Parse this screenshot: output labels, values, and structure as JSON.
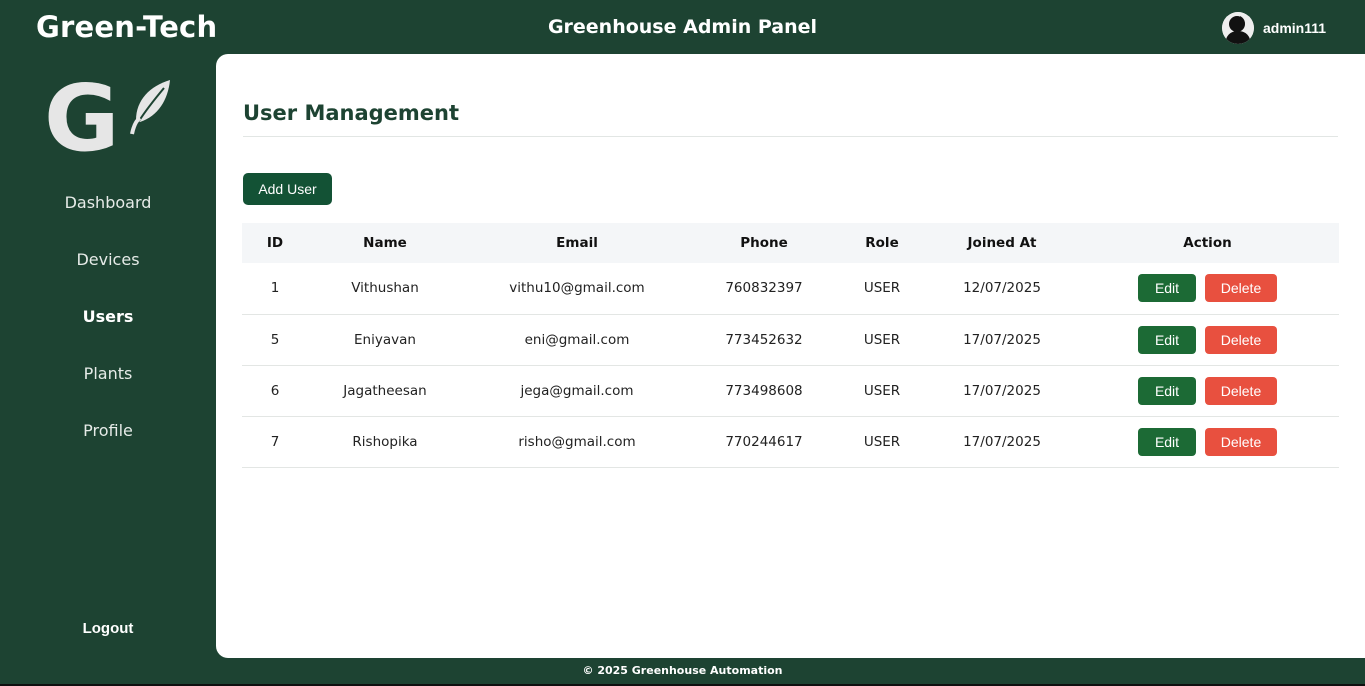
{
  "header": {
    "brand": "Green-Tech",
    "title": "Greenhouse Admin Panel",
    "username": "admin111"
  },
  "sidebar": {
    "logo_text": "G",
    "items": [
      {
        "label": "Dashboard",
        "active": false
      },
      {
        "label": "Devices",
        "active": false
      },
      {
        "label": "Users",
        "active": true
      },
      {
        "label": "Plants",
        "active": false
      },
      {
        "label": "Profile",
        "active": false
      }
    ],
    "logout": "Logout"
  },
  "main": {
    "title": "User Management",
    "add_button": "Add User",
    "table": {
      "headers": [
        "ID",
        "Name",
        "Email",
        "Phone",
        "Role",
        "Joined At",
        "Action"
      ],
      "rows": [
        {
          "id": "1",
          "name": "Vithushan",
          "email": "vithu10@gmail.com",
          "phone": "760832397",
          "role": "USER",
          "joined": "12/07/2025"
        },
        {
          "id": "5",
          "name": "Eniyavan",
          "email": "eni@gmail.com",
          "phone": "773452632",
          "role": "USER",
          "joined": "17/07/2025"
        },
        {
          "id": "6",
          "name": "Jagatheesan",
          "email": "jega@gmail.com",
          "phone": "773498608",
          "role": "USER",
          "joined": "17/07/2025"
        },
        {
          "id": "7",
          "name": "Rishopika",
          "email": "risho@gmail.com",
          "phone": "770244617",
          "role": "USER",
          "joined": "17/07/2025"
        }
      ],
      "edit_label": "Edit",
      "delete_label": "Delete"
    }
  },
  "footer": {
    "text": "© 2025 Greenhouse Automation"
  },
  "colors": {
    "sidebar_bg": "#1d4332",
    "primary_button": "#135235",
    "edit_button": "#1c6a35",
    "delete_button": "#e8503f",
    "content_bg": "#ffffff"
  },
  "icons": {
    "avatar": "user-avatar-icon",
    "logo": "leaf-logo-icon"
  }
}
